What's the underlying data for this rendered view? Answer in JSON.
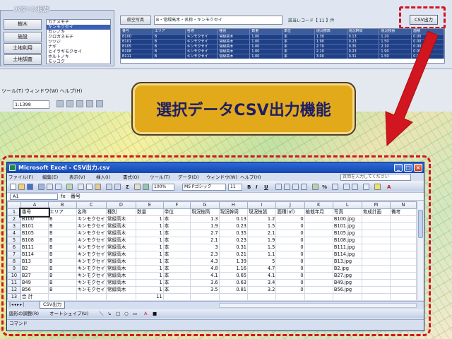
{
  "background_app": {
    "pattern_panel": {
      "title": "パターン検索",
      "buttons": [
        "樹木",
        "施設",
        "土地利用",
        "土地調査"
      ],
      "species_list": [
        "カナメモチ",
        "キンモクセイ",
        "カシノキ",
        "クロガネモチ",
        "ツツジ",
        "ナギ",
        "ヒイラギモクセイ",
        "ホルトノキ",
        "モッコク"
      ],
      "selected_index": 1
    },
    "aerial_button": "航空写真",
    "condition_field": "B・常緑高木・名称・キンモクセイ",
    "count_text": "該当レコード【 11 】件",
    "csv_button": "CSV出力",
    "top_grid": {
      "columns": [
        "番号",
        "エリア",
        "名称",
        "種別",
        "数量",
        "単位",
        "現況樹高",
        "現況幹周",
        "現況枝張",
        "面積"
      ],
      "rows": [
        [
          "B100",
          "B",
          "キンモクセイ",
          "常緑高木",
          "1.00",
          "本",
          "1.30",
          "0.13",
          "1.20",
          "0.00"
        ],
        [
          "B101",
          "B",
          "キンモクセイ",
          "常緑高木",
          "1.00",
          "本",
          "1.90",
          "0.23",
          "1.50",
          "0.00"
        ],
        [
          "B105",
          "B",
          "キンモクセイ",
          "常緑高木",
          "1.00",
          "本",
          "2.70",
          "0.35",
          "2.10",
          "0.00"
        ],
        [
          "B108",
          "B",
          "キンモクセイ",
          "常緑高木",
          "1.00",
          "本",
          "2.10",
          "0.23",
          "1.90",
          "0.00"
        ],
        [
          "B111",
          "B",
          "キンモクセイ",
          "常緑高木",
          "1.00",
          "本",
          "3.00",
          "0.31",
          "1.50",
          "0.00"
        ]
      ]
    },
    "gis_menu": "ツール(T)  ウィンドウ(W)  ヘルプ(H)",
    "scale_value": "1:1398"
  },
  "callout": {
    "text": "選択データCSV出力機能"
  },
  "excel": {
    "title": "Microsoft Excel - CSV出力.csv",
    "menu": [
      "ファイル(F)",
      "編集(E)",
      "表示(V)",
      "挿入(I)",
      "書式(O)",
      "ツール(T)",
      "データ(D)",
      "ウィンドウ(W)",
      "ヘルプ(H)"
    ],
    "help_placeholder": "質問を入力してください",
    "toolbar": {
      "zoom": "100%",
      "font": "MS Pゴシック",
      "font_size": "11",
      "bold": "B",
      "italic": "I",
      "underline": "U"
    },
    "name_box": "A1",
    "fx": "fx",
    "formula": "番号",
    "column_headers": [
      "A",
      "B",
      "C",
      "D",
      "E",
      "F",
      "G",
      "H",
      "I",
      "J",
      "K",
      "L",
      "M",
      "N"
    ],
    "rows": [
      [
        "番号",
        "エリア",
        "名称",
        "種別",
        "数量",
        "単位",
        "現況樹高",
        "現況幹周",
        "現況枝張",
        "面積(㎡)",
        "植栽年月",
        "写真",
        "育成計画",
        "備考"
      ],
      [
        "B100",
        "B",
        "キンモクセイ",
        "常緑高木",
        "1",
        "本",
        "1.3",
        "0.13",
        "1.2",
        "0",
        "",
        "B100.jpg",
        "",
        ""
      ],
      [
        "B101",
        "B",
        "キンモクセイ",
        "常緑高木",
        "1",
        "本",
        "1.9",
        "0.23",
        "1.5",
        "0",
        "",
        "B101.jpg",
        "",
        ""
      ],
      [
        "B105",
        "B",
        "キンモクセイ",
        "常緑高木",
        "1",
        "本",
        "2.7",
        "0.35",
        "2.1",
        "0",
        "",
        "B105.jpg",
        "",
        ""
      ],
      [
        "B108",
        "B",
        "キンモクセイ",
        "常緑高木",
        "1",
        "本",
        "2.1",
        "0.23",
        "1.9",
        "0",
        "",
        "B108.jpg",
        "",
        ""
      ],
      [
        "B111",
        "B",
        "キンモクセイ",
        "常緑高木",
        "1",
        "本",
        "3",
        "0.31",
        "1.5",
        "0",
        "",
        "B111.jpg",
        "",
        ""
      ],
      [
        "B114",
        "B",
        "キンモクセイ",
        "常緑高木",
        "1",
        "本",
        "2.3",
        "0.21",
        "1.1",
        "0",
        "",
        "B114.jpg",
        "",
        ""
      ],
      [
        "B13",
        "B",
        "キンモクセイ",
        "常緑高木",
        "1",
        "本",
        "4.3",
        "1.39",
        "5",
        "0",
        "",
        "B13.jpg",
        "",
        ""
      ],
      [
        "B2",
        "B",
        "キンモクセイ",
        "常緑高木",
        "1",
        "本",
        "4.8",
        "1.16",
        "4.7",
        "0",
        "",
        "B2.jpg",
        "",
        ""
      ],
      [
        "B27",
        "B",
        "キンモクセイ",
        "常緑高木",
        "1",
        "本",
        "4.1",
        "0.65",
        "4.1",
        "0",
        "",
        "B27.jpg",
        "",
        ""
      ],
      [
        "B49",
        "B",
        "キンモクセイ",
        "常緑高木",
        "1",
        "本",
        "3.6",
        "0.63",
        "3.4",
        "0",
        "",
        "B49.jpg",
        "",
        ""
      ],
      [
        "B56",
        "B",
        "キンモクセイ",
        "常緑高木",
        "1",
        "本",
        "3.5",
        "0.81",
        "3.2",
        "0",
        "",
        "B56.jpg",
        "",
        ""
      ],
      [
        "合 計",
        "",
        "",
        "",
        "11",
        "",
        "",
        "",
        "",
        "",
        "",
        "",
        "",
        ""
      ],
      [
        "",
        "",
        "",
        "",
        "",
        "",
        "",
        "",
        "",
        "",
        "",
        "",
        "",
        ""
      ]
    ],
    "numeric_columns": [
      4,
      6,
      7,
      8,
      9
    ],
    "sheet_tab": "CSV出力",
    "draw_toolbar": [
      "図形の調整(R)",
      "オートシェイプ(U)"
    ],
    "status": "コマンド"
  },
  "colors": {
    "highlight_red": "#d1161f",
    "callout_fill": "#e2a91b",
    "callout_text": "#1d1f66",
    "excel_title_blue": "#1446b0"
  }
}
